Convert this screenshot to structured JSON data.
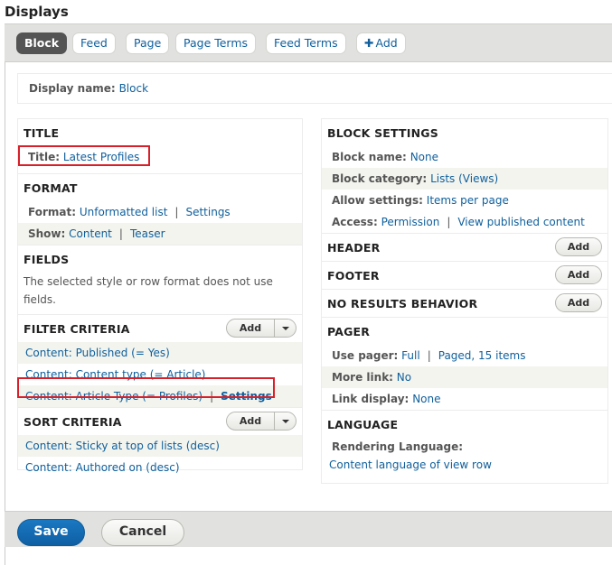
{
  "page_title": "Displays",
  "tabs": [
    {
      "label": "Block",
      "active": true
    },
    {
      "label": "Feed",
      "active": false
    },
    {
      "label": "Page",
      "active": false
    },
    {
      "label": "Page Terms",
      "active": false
    },
    {
      "label": "Feed Terms",
      "active": false
    },
    {
      "label": "Add",
      "icon": "plus-icon",
      "active": false
    }
  ],
  "display_name": {
    "label": "Display name:",
    "value": "Block"
  },
  "left": {
    "title": {
      "heading": "TITLE",
      "label": "Title:",
      "value": "Latest Profiles"
    },
    "format": {
      "heading": "FORMAT",
      "rows": [
        {
          "label": "Format:",
          "value": "Unformatted list",
          "extra": "Settings"
        },
        {
          "label": "Show:",
          "value": "Content",
          "extra": "Teaser"
        }
      ]
    },
    "fields": {
      "heading": "FIELDS",
      "note": "The selected style or row format does not use fields."
    },
    "filter_criteria": {
      "heading": "FILTER CRITERIA",
      "add_label": "Add",
      "items": [
        "Content: Published (= Yes)",
        "Content: Content type (= Article)",
        "Content: Article Type (= Profiles)"
      ],
      "settings_label": "Settings"
    },
    "sort_criteria": {
      "heading": "SORT CRITERIA",
      "add_label": "Add",
      "items": [
        "Content: Sticky at top of lists (desc)",
        "Content: Authored on (desc)"
      ]
    }
  },
  "right": {
    "block_settings": {
      "heading": "BLOCK SETTINGS",
      "rows": [
        {
          "label": "Block name:",
          "value": "None"
        },
        {
          "label": "Block category:",
          "value": "Lists (Views)"
        },
        {
          "label": "Allow settings:",
          "value": "Items per page"
        },
        {
          "label": "Access:",
          "value": "Permission",
          "extra": "View published content"
        }
      ]
    },
    "header": {
      "heading": "HEADER",
      "add_label": "Add"
    },
    "footer": {
      "heading": "FOOTER",
      "add_label": "Add"
    },
    "no_results": {
      "heading": "NO RESULTS BEHAVIOR",
      "add_label": "Add"
    },
    "pager": {
      "heading": "PAGER",
      "rows": [
        {
          "label": "Use pager:",
          "value": "Full",
          "extra": "Paged, 15 items"
        },
        {
          "label": "More link:",
          "value": "No"
        },
        {
          "label": "Link display:",
          "value": "None"
        }
      ]
    },
    "language": {
      "heading": "LANGUAGE",
      "label": "Rendering Language:",
      "value": "Content language of view row"
    }
  },
  "actions": {
    "save": "Save",
    "cancel": "Cancel"
  },
  "colors": {
    "link": "#0f5f9c",
    "active_tab": "#545454",
    "highlight": "#d8202a",
    "save": "#0f6bb3"
  }
}
